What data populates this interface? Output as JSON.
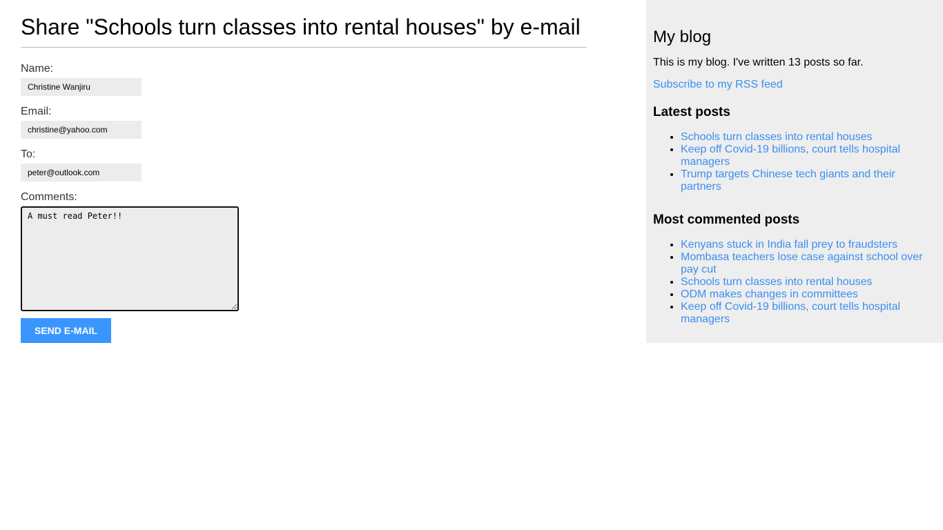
{
  "page": {
    "title": "Share \"Schools turn classes into rental houses\" by e-mail"
  },
  "form": {
    "name_label": "Name:",
    "name_value": "Christine Wanjiru",
    "email_label": "Email:",
    "email_value": "christine@yahoo.com",
    "to_label": "To:",
    "to_value": "peter@outlook.com",
    "comments_label": "Comments:",
    "comments_value": "A must read Peter!!",
    "submit_label": "Send e-mail"
  },
  "sidebar": {
    "title": "My blog",
    "description": "This is my blog. I've written 13 posts so far.",
    "rss_link": "Subscribe to my RSS feed",
    "latest_heading": "Latest posts",
    "latest_posts": [
      "Schools turn classes into rental houses",
      "Keep off Covid-19 billions, court tells hospital managers",
      "Trump targets Chinese tech giants and their partners"
    ],
    "most_commented_heading": "Most commented posts",
    "most_commented_posts": [
      "Kenyans stuck in India fall prey to fraudsters",
      "Mombasa teachers lose case against school over pay cut",
      "Schools turn classes into rental houses",
      "ODM makes changes in committees",
      "Keep off Covid-19 billions, court tells hospital managers"
    ]
  },
  "colors": {
    "accent": "#3a96fd",
    "link": "#3a8ef0",
    "sidebar_bg": "#eeeeee",
    "input_bg": "#ececec"
  }
}
